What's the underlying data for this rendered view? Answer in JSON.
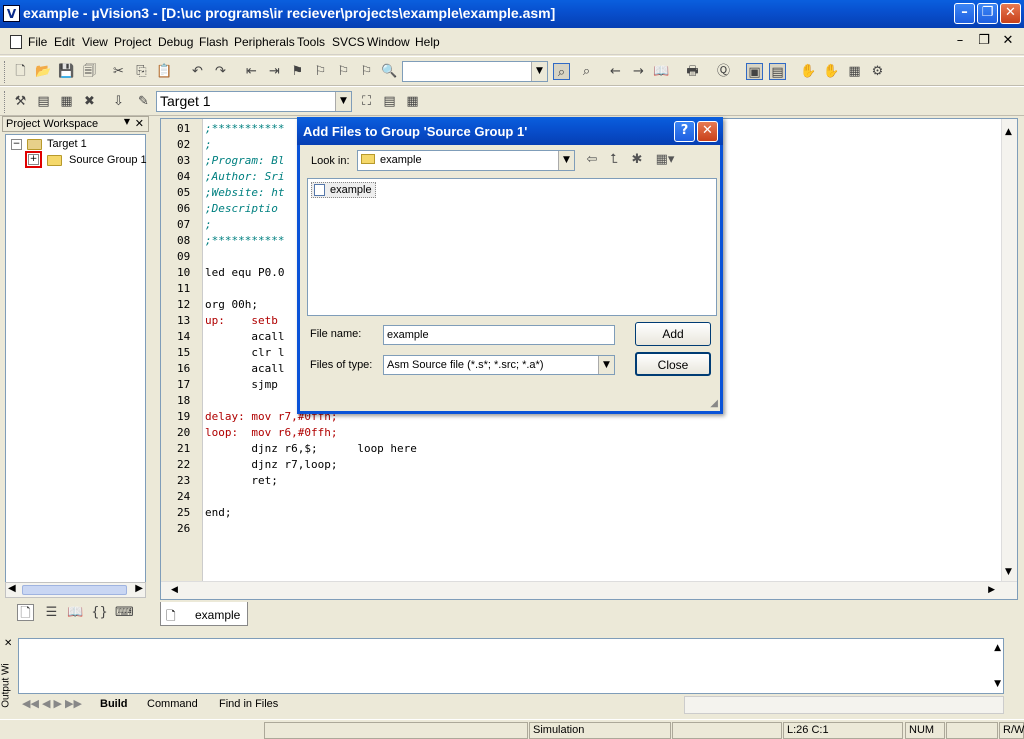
{
  "window": {
    "title": "example  - µVision3 - [D:\\uc programs\\ir reciever\\projects\\example\\example.asm]",
    "icon_glyph": "V"
  },
  "menu": [
    "File",
    "Edit",
    "View",
    "Project",
    "Debug",
    "Flash",
    "Peripherals",
    "Tools",
    "SVCS",
    "Window",
    "Help"
  ],
  "toolbar2": {
    "target": "Target 1"
  },
  "workspace": {
    "title": "Project Workspace",
    "tree": {
      "root": "Target 1",
      "child": "Source Group 1"
    }
  },
  "editor": {
    "line_numbers": [
      "01",
      "02",
      "03",
      "04",
      "05",
      "06",
      "07",
      "08",
      "09",
      "10",
      "11",
      "12",
      "13",
      "14",
      "15",
      "16",
      "17",
      "18",
      "19",
      "20",
      "21",
      "22",
      "23",
      "24",
      "25",
      "26"
    ],
    "lines": [
      ";***********",
      ";",
      ";Program: Bl",
      ";Author: Sri",
      ";Website: ht",
      ";Descriptio",
      ";",
      ";***********",
      "",
      "led equ P0.0",
      "",
      "org 00h;",
      "up:    setb",
      "       acall",
      "       clr l",
      "       acall",
      "       sjmp",
      "",
      "delay: mov r7,#0ffh;",
      "loop:  mov r6,#0ffh;",
      "       djnz r6,$;      loop here",
      "       djnz r7,loop;",
      "       ret;",
      "",
      "end;",
      ""
    ],
    "file_tab": "example"
  },
  "dialog": {
    "title": "Add Files to Group 'Source Group 1'",
    "look_in_label": "Look in:",
    "look_in_value": "example",
    "file_item": "example",
    "file_name_label": "File name:",
    "file_name_value": "example",
    "files_of_type_label": "Files of type:",
    "files_of_type_value": "Asm Source file (*.s*; *.src; *.a*)",
    "add_label": "Add",
    "close_label": "Close"
  },
  "output": {
    "side_label": "Output Wi",
    "tabs": [
      "Build",
      "Command",
      "Find in Files"
    ]
  },
  "status": {
    "mode": "Simulation",
    "position": "L:26 C:1",
    "num": "NUM",
    "rw": "R/W"
  },
  "colors": {
    "titlebar": "#0a5fde",
    "highlight": "#e00000",
    "comment": "#008080",
    "label": "#b00000"
  }
}
